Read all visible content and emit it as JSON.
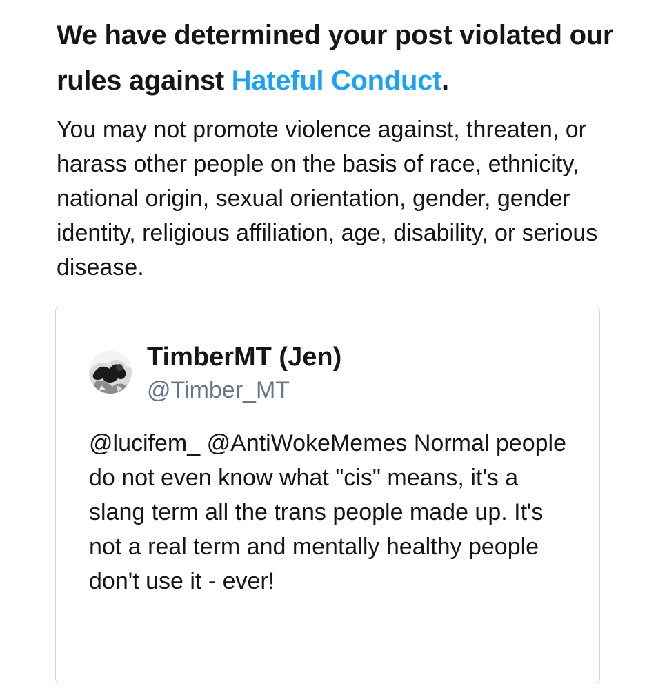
{
  "notice": {
    "headline_prefix": "We have determined your post violated our rules against ",
    "headline_link": "Hateful Conduct",
    "headline_suffix": ".",
    "rule_description": "You may not promote violence against, threaten, or harass other people on the basis of race, ethnicity, national origin, sexual orientation, gender, gender identity, religious affiliation, age, disability, or serious disease."
  },
  "tweet": {
    "display_name": "TimberMT (Jen)",
    "handle": "@Timber_MT",
    "text": "@lucifem_ @AntiWokeMemes Normal people do not even know what \"cis\" means, it's a slang term all the trans people made up. It's not a real term and mentally healthy people don't use it - ever!"
  },
  "colors": {
    "link": "#1da1f2",
    "text": "#14171a",
    "muted": "#657786",
    "border": "#ccd6dd"
  }
}
